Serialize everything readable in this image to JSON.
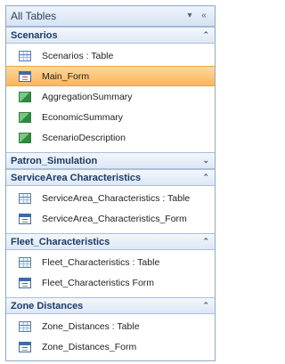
{
  "pane": {
    "title": "All Tables",
    "dropdown_glyph": "▾",
    "collapse_glyph": "«"
  },
  "groups": [
    {
      "name": "Scenarios",
      "chevron": "⌃",
      "items": [
        {
          "label": "Scenarios : Table",
          "type": "table",
          "icon": "table-icon"
        },
        {
          "label": "Main_Form",
          "type": "form",
          "icon": "form-icon",
          "selected": true
        },
        {
          "label": "AggregationSummary",
          "type": "query",
          "icon": "query-icon"
        },
        {
          "label": "EconomicSummary",
          "type": "query",
          "icon": "query-icon"
        },
        {
          "label": "ScenarioDescription",
          "type": "query",
          "icon": "query-icon"
        }
      ]
    },
    {
      "name": "Patron_Simulation",
      "chevron": "⌄",
      "items": []
    },
    {
      "name": "ServiceArea Characteristics",
      "chevron": "⌃",
      "items": [
        {
          "label": "ServiceArea_Characteristics : Table",
          "type": "table",
          "icon": "table-icon"
        },
        {
          "label": "ServiceArea_Characteristics_Form",
          "type": "form",
          "icon": "form-icon"
        }
      ]
    },
    {
      "name": "Fleet_Characteristics",
      "chevron": "⌃",
      "items": [
        {
          "label": "Fleet_Characteristics : Table",
          "type": "table",
          "icon": "table-icon"
        },
        {
          "label": "Fleet_Characteristics Form",
          "type": "form",
          "icon": "form-icon"
        }
      ]
    },
    {
      "name": "Zone Distances",
      "chevron": "⌃",
      "items": [
        {
          "label": "Zone_Distances : Table",
          "type": "table",
          "icon": "table-icon"
        },
        {
          "label": "Zone_Distances_Form",
          "type": "form",
          "icon": "form-icon"
        }
      ]
    }
  ],
  "colors": {
    "selected_bg": "#f9b75a",
    "group_header_text": "#1d3b66",
    "border": "#8fa8c8"
  }
}
